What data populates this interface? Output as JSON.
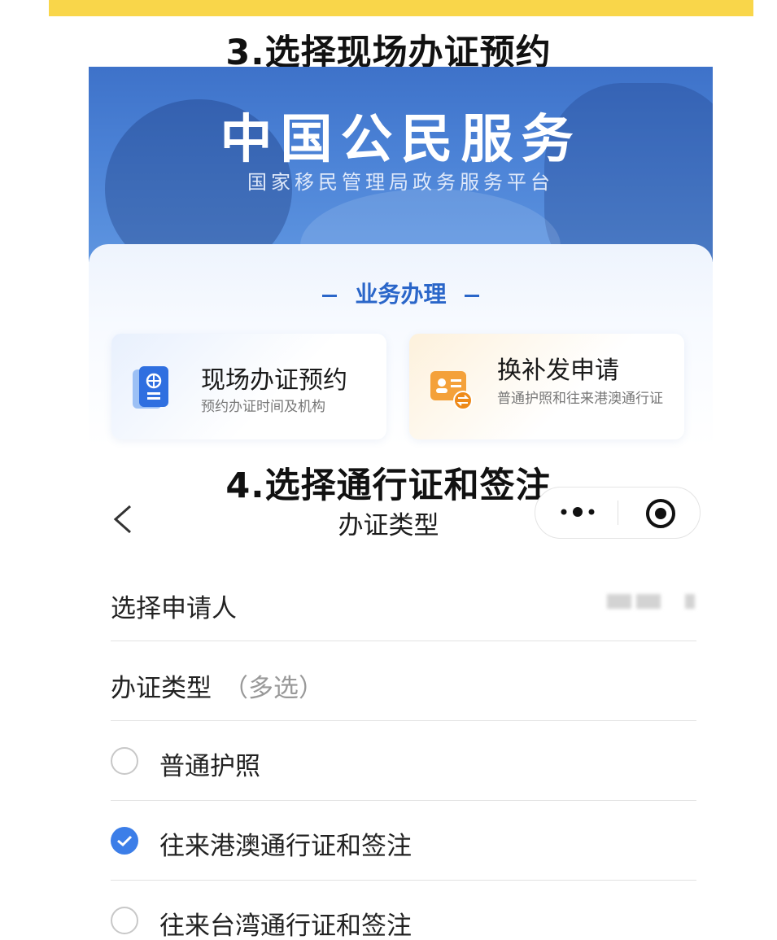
{
  "step3_title": "3.选择现场办证预约",
  "banner": {
    "title": "中国公民服务",
    "subtitle": "国家移民管理局政务服务平台"
  },
  "business": {
    "heading": "业务办理",
    "cards": [
      {
        "title": "现场办证预约",
        "subtitle": "预约办证时间及机构",
        "icon": "passport-icon"
      },
      {
        "title": "换补发申请",
        "subtitle": "普通护照和往来港澳通行证",
        "icon": "id-card-exchange-icon"
      }
    ]
  },
  "step4_title": "4.选择通行证和签注",
  "nav": {
    "title": "办证类型",
    "icons": [
      "back-chevron-icon",
      "more-dots-icon",
      "target-icon"
    ]
  },
  "form": {
    "applicant_label": "选择申请人",
    "type_label": "办证类型",
    "type_hint": "（多选）",
    "options": [
      {
        "label": "普通护照",
        "checked": false
      },
      {
        "label": "往来港澳通行证和签注",
        "checked": true
      },
      {
        "label": "往来台湾通行证和签注",
        "checked": false
      }
    ]
  },
  "colors": {
    "accent_yellow": "#f9d64a",
    "primary_blue": "#2a66c9",
    "check_blue": "#3c7ee8"
  }
}
